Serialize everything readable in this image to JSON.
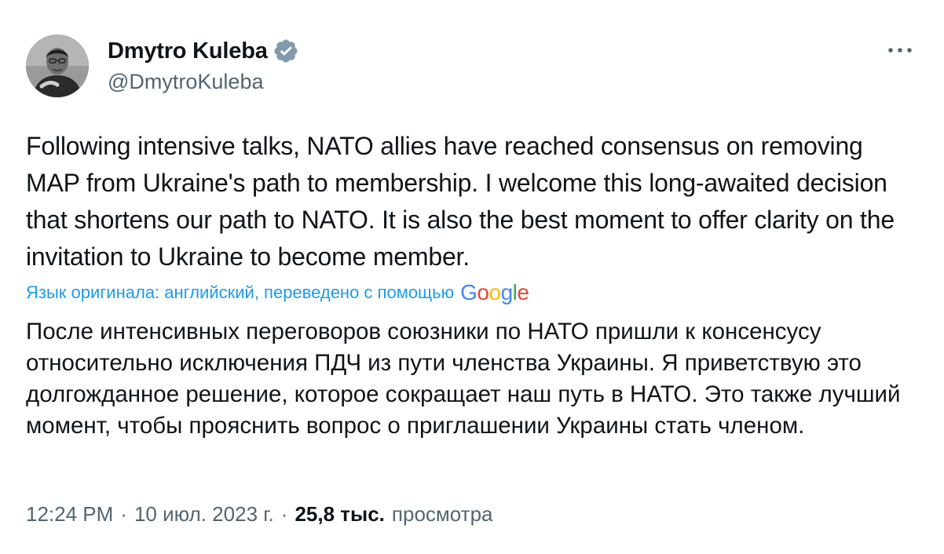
{
  "author": {
    "display_name": "Dmytro Kuleba",
    "handle": "@DmytroKuleba",
    "verified": true
  },
  "tweet": {
    "text": "Following intensive talks, NATO allies have reached consensus on removing MAP from Ukraine's path to membership. I welcome this long-awaited decision that shortens our path to NATO. It is also the best moment to offer clarity on the invitation to Ukraine to become member.",
    "translation_note": "Язык оригинала: английский, переведено с помощью",
    "translation_provider": "Google",
    "translated_text": "После интенсивных переговоров союзники по НАТО пришли к консенсусу относительно исключения ПДЧ из пути членства Украины. Я приветствую это долгожданное решение, которое сокращает наш путь в НАТО. Это также лучший момент, чтобы прояснить вопрос о приглашении Украины стать членом.",
    "time": "12:24 PM",
    "date": "10 июл. 2023 г.",
    "separator": "·",
    "views_count": "25,8 тыс.",
    "views_label": "просмотра"
  },
  "icons": {
    "verified": "verified-badge-icon",
    "more": "more-options-icon"
  },
  "colors": {
    "text_primary": "#0f1419",
    "text_secondary": "#536471",
    "accent": "#1d9bf0",
    "google_blue": "#4285F4",
    "google_red": "#EA4335",
    "google_yellow": "#FBBC05",
    "google_green": "#34A853"
  }
}
